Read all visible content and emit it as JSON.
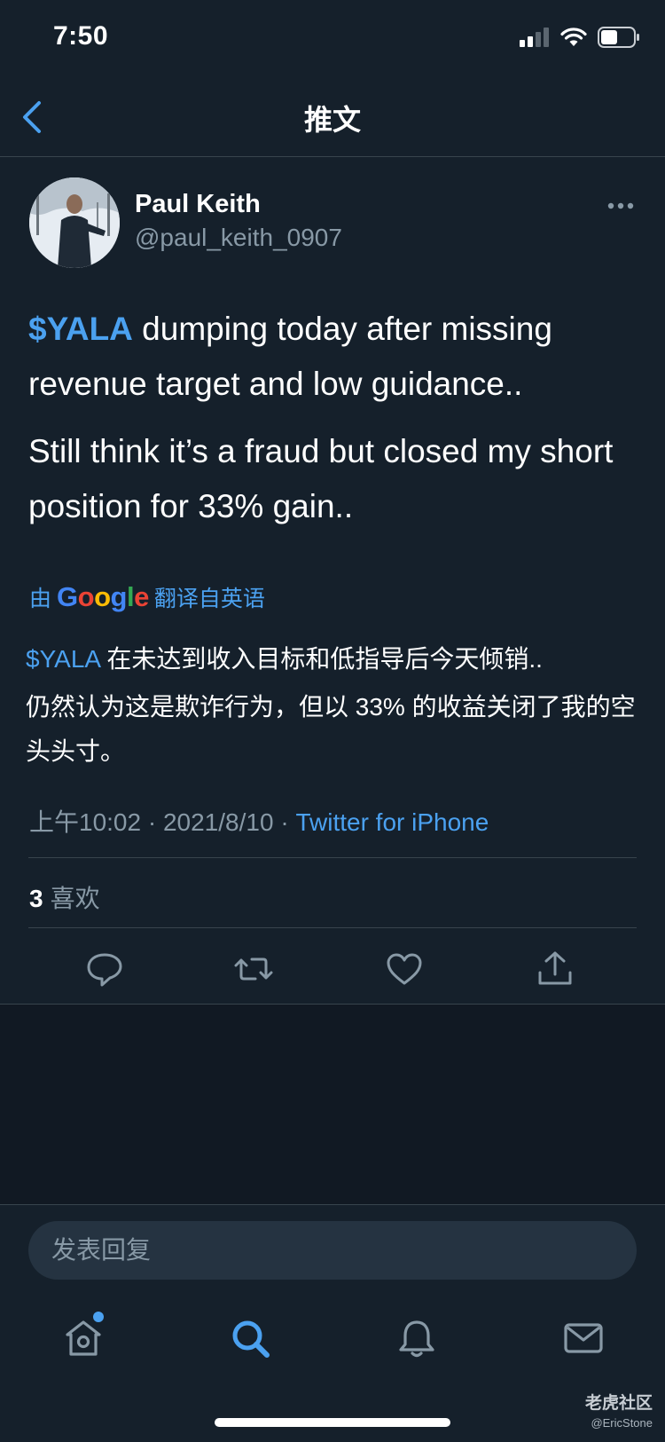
{
  "status_bar": {
    "time": "7:50"
  },
  "header": {
    "title": "推文"
  },
  "tweet": {
    "author_name": "Paul Keith",
    "author_handle": "@paul_keith_0907",
    "cashtag": "$YALA",
    "text_line1_rest": " dumping today after missing revenue target and low guidance..",
    "text_paragraph2": "Still think it’s a fraud but closed my short position for 33% gain..",
    "translate_prefix": "由",
    "translate_suffix": "翻译自英语",
    "translation_cashtag": "$YALA",
    "translation_line1_rest": " 在未达到收入目标和低指导后今天倾销..",
    "translation_paragraph2": "仍然认为这是欺诈行为，但以 33% 的收益关闭了我的空头头寸。",
    "time": "上午10:02",
    "separator": " · ",
    "date": "2021/8/10",
    "source": "Twitter for iPhone",
    "likes_count": "3",
    "likes_label": "喜欢"
  },
  "reply": {
    "placeholder": "发表回复"
  },
  "watermark": {
    "title": "老虎社区",
    "user": "@EricStone"
  },
  "colors": {
    "background": "#15202b",
    "accent": "#4ba1f0",
    "secondary_text": "#8899a6",
    "divider": "#38444d"
  },
  "icons": [
    "back-chevron-icon",
    "more-icon",
    "reply-icon",
    "retweet-icon",
    "like-icon",
    "share-icon",
    "home-icon",
    "search-icon",
    "notifications-icon",
    "messages-icon"
  ]
}
